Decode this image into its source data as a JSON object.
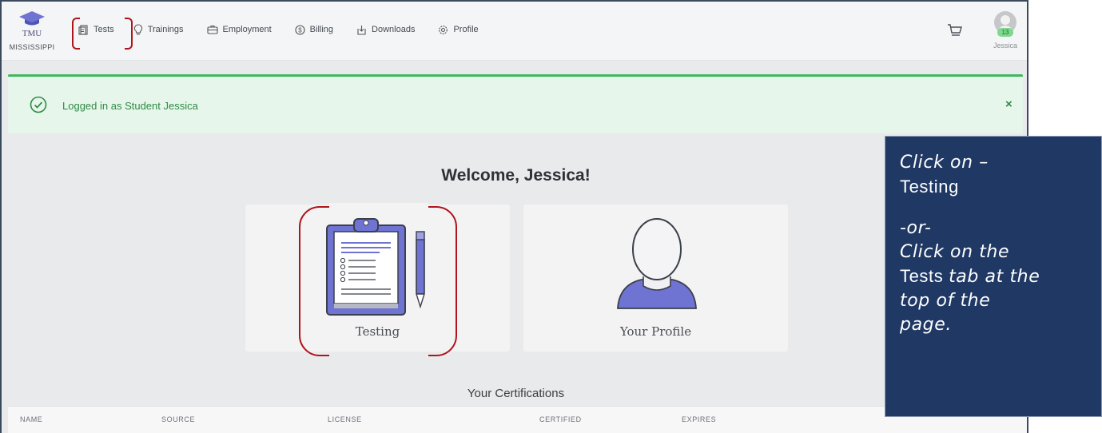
{
  "logo": {
    "name": "TMU",
    "subtitle": "MISSISSIPPI"
  },
  "nav": {
    "items": [
      {
        "label": "Tests",
        "icon": "tests-icon"
      },
      {
        "label": "Trainings",
        "icon": "lightbulb-icon"
      },
      {
        "label": "Employment",
        "icon": "briefcase-icon"
      },
      {
        "label": "Billing",
        "icon": "dollar-icon"
      },
      {
        "label": "Downloads",
        "icon": "download-icon"
      },
      {
        "label": "Profile",
        "icon": "gear-icon"
      }
    ]
  },
  "user": {
    "name": "Jessica",
    "badge_count": "13"
  },
  "alert": {
    "message": "Logged in as Student Jessica",
    "close": "×"
  },
  "main": {
    "welcome": "Welcome, Jessica!",
    "cards": [
      {
        "label": "Testing",
        "icon": "clipboard-icon"
      },
      {
        "label": "Your Profile",
        "icon": "person-icon"
      }
    ]
  },
  "certifications": {
    "title": "Your Certifications",
    "columns": [
      "NAME",
      "SOURCE",
      "LICENSE",
      "CERTIFIED",
      "EXPIRES"
    ]
  },
  "callout": {
    "line1_italic": "Click on –",
    "line1_bold": "Testing",
    "line2": "-or-",
    "line3": "Click on the",
    "line4_bold": "Tests",
    "line4_italic": "tab at the",
    "line5": "top of the",
    "line6": "page."
  },
  "colors": {
    "accent": "#6f73d2",
    "success": "#3fb760",
    "highlight": "#b0141a",
    "callout_bg": "#1f3864"
  }
}
